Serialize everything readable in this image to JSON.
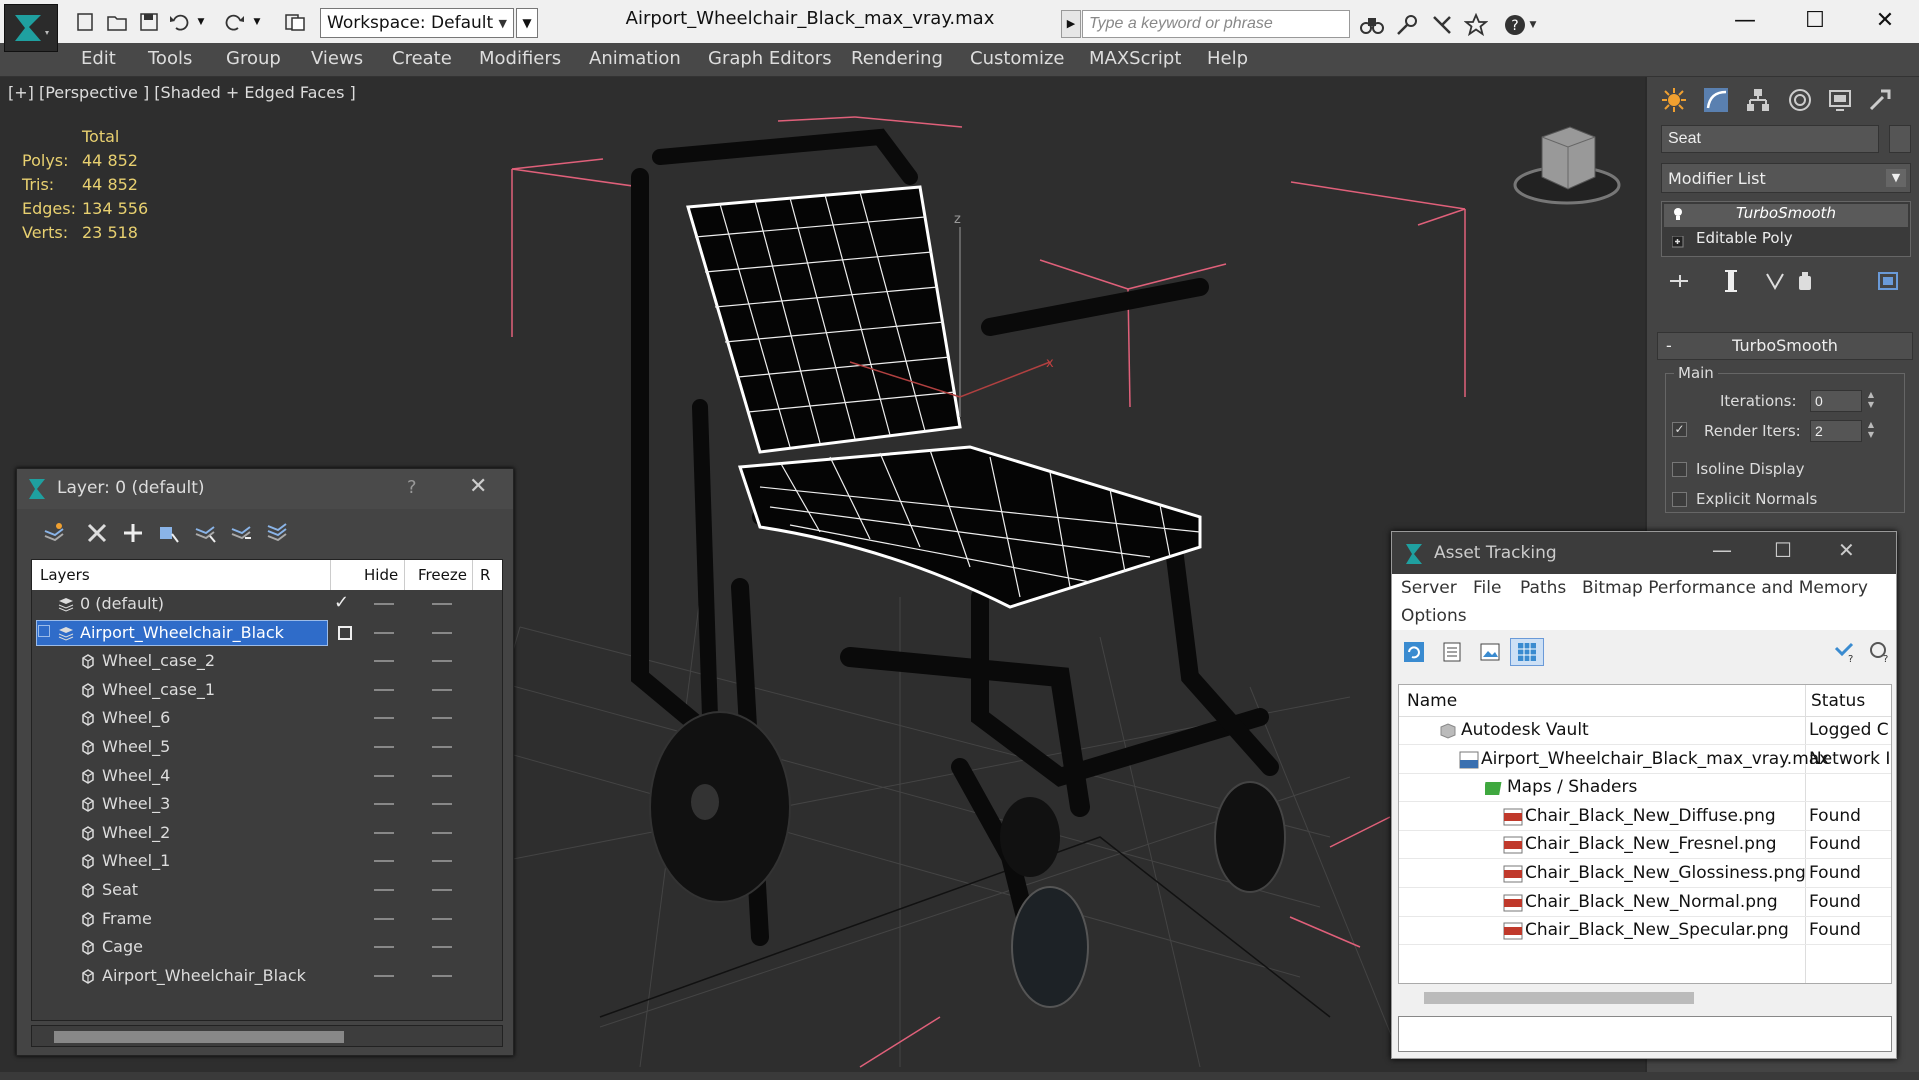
{
  "titlebar": {
    "workspace_label": "Workspace: Default",
    "doc_title": "Airport_Wheelchair_Black_max_vray.max",
    "search_placeholder": "Type a keyword or phrase"
  },
  "menu": [
    "Edit",
    "Tools",
    "Group",
    "Views",
    "Create",
    "Modifiers",
    "Animation",
    "Graph Editors",
    "Rendering",
    "Customize",
    "MAXScript",
    "Help"
  ],
  "viewport": {
    "label": "[+] [Perspective ] [Shaded + Edged Faces ]",
    "stats_header": "Total",
    "stats": [
      {
        "label": "Polys:",
        "value": "44 852"
      },
      {
        "label": "Tris:",
        "value": "44 852"
      },
      {
        "label": "Edges:",
        "value": "134 556"
      },
      {
        "label": "Verts:",
        "value": "23 518"
      }
    ],
    "axis_labels": {
      "z": "z",
      "x": "x"
    }
  },
  "command_panel": {
    "object_name": "Seat",
    "modifier_list_label": "Modifier List",
    "stack": [
      "TurboSmooth",
      "Editable Poly"
    ],
    "rollout_title": "TurboSmooth",
    "group_label": "Main",
    "iterations_label": "Iterations:",
    "iterations_value": "0",
    "render_iters_label": "Render Iters:",
    "render_iters_value": "2",
    "isoline_label": "Isoline Display",
    "explicit_normals_label": "Explicit Normals"
  },
  "layer_dialog": {
    "title": "Layer: 0 (default)",
    "help": "?",
    "columns": {
      "layers": "Layers",
      "hide": "Hide",
      "freeze": "Freeze",
      "r": "R"
    },
    "rows": [
      {
        "name": "0 (default)",
        "level": 0
      },
      {
        "name": "Airport_Wheelchair_Black",
        "level": 0
      },
      {
        "name": "Wheel_case_2",
        "level": 1
      },
      {
        "name": "Wheel_case_1",
        "level": 1
      },
      {
        "name": "Wheel_6",
        "level": 1
      },
      {
        "name": "Wheel_5",
        "level": 1
      },
      {
        "name": "Wheel_4",
        "level": 1
      },
      {
        "name": "Wheel_3",
        "level": 1
      },
      {
        "name": "Wheel_2",
        "level": 1
      },
      {
        "name": "Wheel_1",
        "level": 1
      },
      {
        "name": "Seat",
        "level": 1
      },
      {
        "name": "Frame",
        "level": 1
      },
      {
        "name": "Cage",
        "level": 1
      },
      {
        "name": "Airport_Wheelchair_Black",
        "level": 1
      }
    ]
  },
  "asset_tracking": {
    "title": "Asset Tracking",
    "menu": [
      "Server",
      "File",
      "Paths",
      "Bitmap Performance and Memory",
      "Options"
    ],
    "columns": {
      "name": "Name",
      "status": "Status"
    },
    "rows": [
      {
        "name": "Autodesk Vault",
        "status": "Logged C"
      },
      {
        "name": "Airport_Wheelchair_Black_max_vray.max",
        "status": "Network I"
      },
      {
        "name": "Maps / Shaders",
        "status": ""
      },
      {
        "name": "Chair_Black_New_Diffuse.png",
        "status": "Found"
      },
      {
        "name": "Chair_Black_New_Fresnel.png",
        "status": "Found"
      },
      {
        "name": "Chair_Black_New_Glossiness.png",
        "status": "Found"
      },
      {
        "name": "Chair_Black_New_Normal.png",
        "status": "Found"
      },
      {
        "name": "Chair_Black_New_Specular.png",
        "status": "Found"
      }
    ]
  },
  "colors": {
    "selection_blue": "#2f6cc9",
    "stats_yellow": "#e8d070",
    "bbox_pink": "#e0607a"
  }
}
